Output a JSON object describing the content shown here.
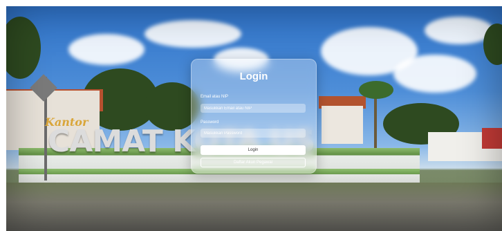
{
  "background": {
    "sign_script": "Kantor",
    "sign_letters": "CAMAT KOTA   US"
  },
  "login": {
    "title": "Login",
    "email_label": "Email atau NIP",
    "email_placeholder": "Masukkan Email atau NIP",
    "password_label": "Password",
    "password_placeholder": "Masukkan Password",
    "login_button": "Login",
    "register_button": "Daftar Akun Pegawai"
  },
  "colors": {
    "card_bg": "rgba(255,255,255,0.30)",
    "button_primary": "#ffffff"
  }
}
